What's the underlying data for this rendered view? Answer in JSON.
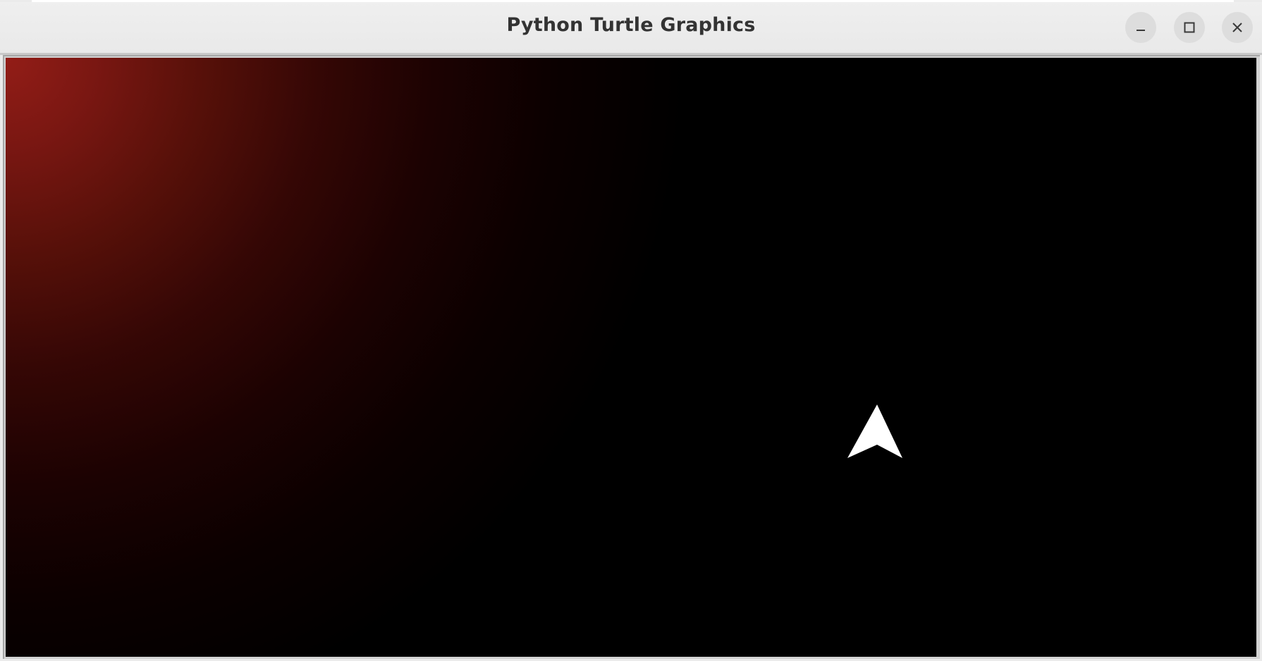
{
  "window": {
    "title": "Python Turtle Graphics",
    "controls": {
      "minimize_icon": "minimize-icon",
      "maximize_icon": "maximize-icon",
      "close_icon": "close-icon"
    }
  },
  "canvas": {
    "background_glow_color": "#931d17",
    "background_base_color": "#000000",
    "turtle": {
      "shape": "arrow-cursor-icon",
      "color": "#ffffff",
      "heading": "up"
    }
  }
}
